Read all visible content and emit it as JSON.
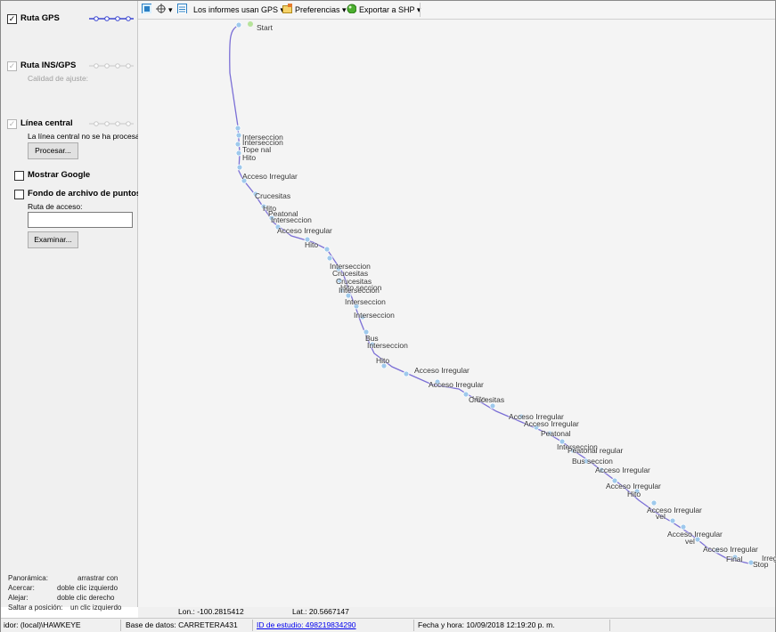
{
  "left_panel": {
    "ruta_gps": {
      "label": "Ruta GPS",
      "checked": true
    },
    "ruta_ins": {
      "label": "Ruta INS/GPS",
      "checked": true,
      "quality_label": "Calidad de ajuste:"
    },
    "linea_central": {
      "label": "Línea central",
      "checked": true,
      "note": "La línea central no se ha procesado",
      "button": "Procesar..."
    },
    "mostrar_google": {
      "label": "Mostrar Google",
      "checked": false
    },
    "fondo_puntos": {
      "label": "Fondo de archivo de puntos",
      "checked": false,
      "path_label": "Ruta de acceso:",
      "path_value": "",
      "button": "Examinar..."
    },
    "help": [
      {
        "action": "Panorámica:",
        "how": "arrastrar con"
      },
      {
        "action": "Acercar:",
        "how": "doble clic izquierdo"
      },
      {
        "action": "Alejar:",
        "how": "doble clic derecho"
      },
      {
        "action": "Saltar a posición:",
        "how": "un clic izquierdo"
      }
    ]
  },
  "toolbar": {
    "reports": "Los informes usan GPS",
    "preferences": "Preferencias",
    "export": "Exportar a SHP",
    "icons": [
      "layers-icon",
      "crosshair-icon",
      "report-icon",
      "preferences-icon",
      "export-icon"
    ]
  },
  "map": {
    "labels": [
      {
        "text": "Start"
      },
      {
        "text": "Interseccion"
      },
      {
        "text": "Interseccion"
      },
      {
        "text": "Tope nal"
      },
      {
        "text": "Hito"
      },
      {
        "text": "Acceso Irregular"
      },
      {
        "text": "Crucesitas"
      },
      {
        "text": "Hito"
      },
      {
        "text": "Peatonal"
      },
      {
        "text": "Interseccion"
      },
      {
        "text": "Acceso Irregular"
      },
      {
        "text": "Hito"
      },
      {
        "text": "Interseccion"
      },
      {
        "text": "Crucesitas"
      },
      {
        "text": "Crucesitas"
      },
      {
        "text": "Hito seccion"
      },
      {
        "text": "Interseccion"
      },
      {
        "text": "Interseccion"
      },
      {
        "text": "Interseccion"
      },
      {
        "text": "Bus"
      },
      {
        "text": "Interseccion"
      },
      {
        "text": "Hito"
      },
      {
        "text": "Acceso Irregular"
      },
      {
        "text": "Acceso Irregular"
      },
      {
        "text": "Hito"
      },
      {
        "text": "Crucesitas"
      },
      {
        "text": "Acceso Irregular"
      },
      {
        "text": "Acceso Irregular"
      },
      {
        "text": "Peatonal"
      },
      {
        "text": "Interseccion"
      },
      {
        "text": "Peatonal regular"
      },
      {
        "text": "Bus seccion"
      },
      {
        "text": "Acceso Irregular"
      },
      {
        "text": "Acceso Irregular"
      },
      {
        "text": "Hito"
      },
      {
        "text": "Acceso Irregular"
      },
      {
        "text": "vel"
      },
      {
        "text": "Acceso Irregular"
      },
      {
        "text": "vel"
      },
      {
        "text": "Acceso Irregular"
      },
      {
        "text": "Final"
      },
      {
        "text": "Irregular"
      },
      {
        "text": "Stop"
      }
    ],
    "route_color": "#7b6fd6",
    "marker_color": "#9ec9ec"
  },
  "coords": {
    "lon": "Lon.: -100.2815412",
    "lat": "Lat.:  20.5667147"
  },
  "status": {
    "server": "idor: (local)\\HAWKEYE",
    "database": "Base de datos: CARRETERA431",
    "study_id": "ID de estudio: 498219834290",
    "datetime": "Fecha y hora: 10/09/2018 12:19:20 p. m."
  }
}
